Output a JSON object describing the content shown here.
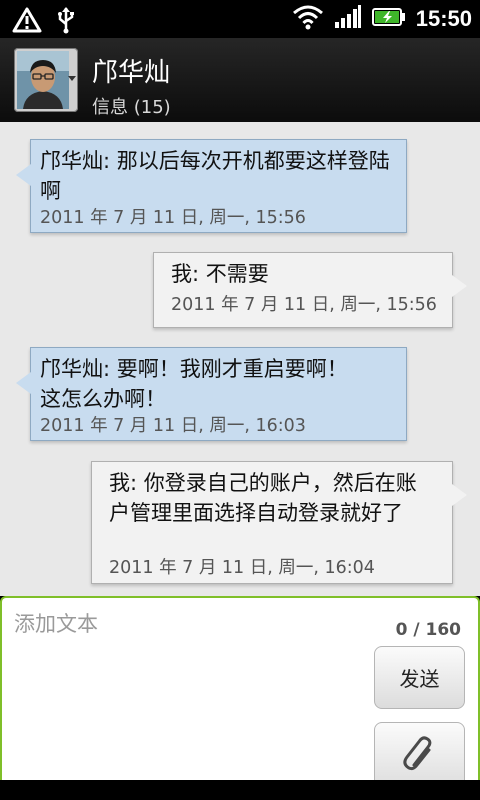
{
  "status_bar": {
    "time": "15:50",
    "icons": [
      "alert-icon",
      "usb-icon",
      "wifi-icon",
      "signal-icon",
      "battery-charging-icon"
    ]
  },
  "header": {
    "contact_name": "邝华灿",
    "message_count": "信息 (15)"
  },
  "conversation": {
    "messages": [
      {
        "direction": "incoming",
        "text": "邝华灿: 那以后每次开机都要这样登陆啊",
        "timestamp": "2011 年 7 月 11 日, 周一, 15:56"
      },
      {
        "direction": "outgoing",
        "text": "我: 不需要",
        "timestamp": "2011 年 7 月 11 日, 周一, 15:56"
      },
      {
        "direction": "incoming",
        "text": "邝华灿: 要啊！我刚才重启要啊！这怎么办啊！",
        "timestamp": "2011 年 7 月 11 日, 周一, 16:03"
      },
      {
        "direction": "outgoing",
        "text": "我: 你登录自己的账户，然后在账户管理里面选择自动登录就好了",
        "timestamp": "2011 年 7 月 11 日, 周一, 16:04"
      }
    ]
  },
  "compose": {
    "placeholder": "添加文本",
    "value": "",
    "char_count": "0 / 160",
    "send_label": "发送",
    "accent_color": "#7fbf29"
  }
}
